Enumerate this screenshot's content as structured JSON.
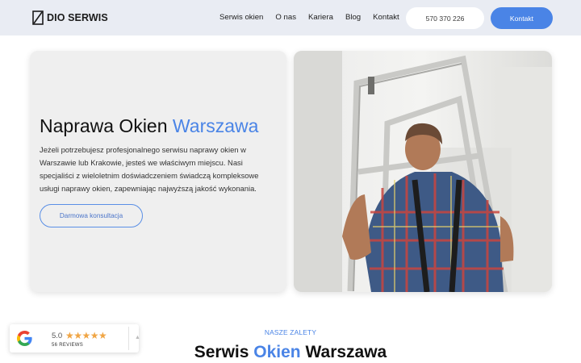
{
  "header": {
    "logo_text": "DIO SERWIS",
    "nav": [
      "Serwis okien",
      "O nas",
      "Kariera",
      "Blog",
      "Kontakt"
    ],
    "phone": "570 370 226",
    "cta": "Kontakt"
  },
  "hero": {
    "title_main": "Naprawa Okien ",
    "title_accent": "Warszawa",
    "description": "Jeżeli potrzebujesz profesjonalnego serwisu naprawy okien w Warszawie lub Krakowie, jesteś we właściwym miejscu. Nasi specjaliści z wieloletnim doświadczeniem świadczą kompleksowe usługi naprawy okien, zapewniając najwyższą jakość wykonania.",
    "button": "Darmowa konsultacja"
  },
  "reviews": {
    "rating": "5.0",
    "stars": "★★★★★",
    "count": "56 REVIEWS"
  },
  "section": {
    "kicker": "NASZE ZALETY",
    "title_a": "Serwis ",
    "title_accent": "Okien",
    "title_b": " Warszawa"
  },
  "colors": {
    "accent": "#4a84e6",
    "header_bg": "#e9ecf3",
    "star": "#f0a544"
  },
  "icons": [
    "logo-mark-icon",
    "google-icon",
    "chevron-up-icon"
  ]
}
